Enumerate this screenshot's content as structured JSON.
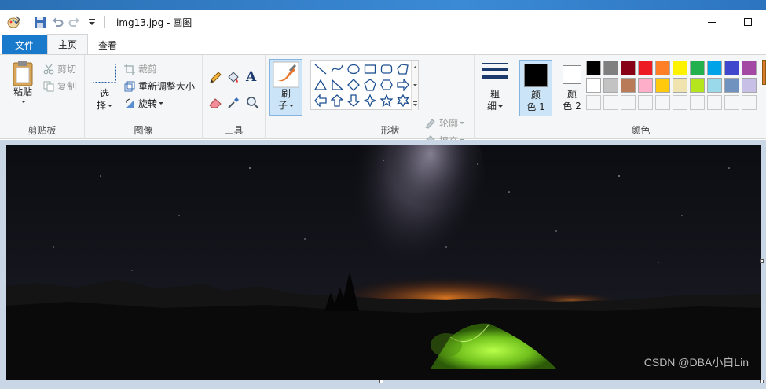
{
  "window": {
    "title": "img13.jpg - 画图"
  },
  "tabs": [
    {
      "label": "文件"
    },
    {
      "label": "主页"
    },
    {
      "label": "查看"
    }
  ],
  "clipboard": {
    "paste_label": "粘贴",
    "cut_label": "剪切",
    "copy_label": "复制",
    "group_label": "剪贴板"
  },
  "image": {
    "select_label_1": "选",
    "select_label_2": "择",
    "crop_label": "裁剪",
    "resize_label": "重新调整大小",
    "rotate_label": "旋转",
    "group_label": "图像"
  },
  "tools": {
    "group_label": "工具",
    "text_glyph": "A"
  },
  "brushes": {
    "label_1": "刷",
    "label_2": "子"
  },
  "shapes": {
    "outline_label": "轮廓",
    "fill_label": "填充",
    "group_label": "形状"
  },
  "size": {
    "label_1": "粗",
    "label_2": "细"
  },
  "colors": {
    "color1_label_1": "颜",
    "color1_label_2": "色 1",
    "color2_label_1": "颜",
    "color2_label_2": "色 2",
    "group_label": "颜色",
    "color1": "#000000",
    "color2": "#ffffff",
    "palette_row1": [
      "#000000",
      "#7f7f7f",
      "#880015",
      "#ed1c24",
      "#ff7f27",
      "#fff200",
      "#22b14c",
      "#00a2e8",
      "#3f48cc",
      "#a349a4"
    ],
    "palette_row2": [
      "#ffffff",
      "#c3c3c3",
      "#b97a57",
      "#ffaec9",
      "#ffc90e",
      "#efe4b0",
      "#b5e61d",
      "#99d9ea",
      "#7092be",
      "#c8bfe7"
    ]
  },
  "canvas": {
    "watermark": "CSDN @DBA小白Lin"
  }
}
